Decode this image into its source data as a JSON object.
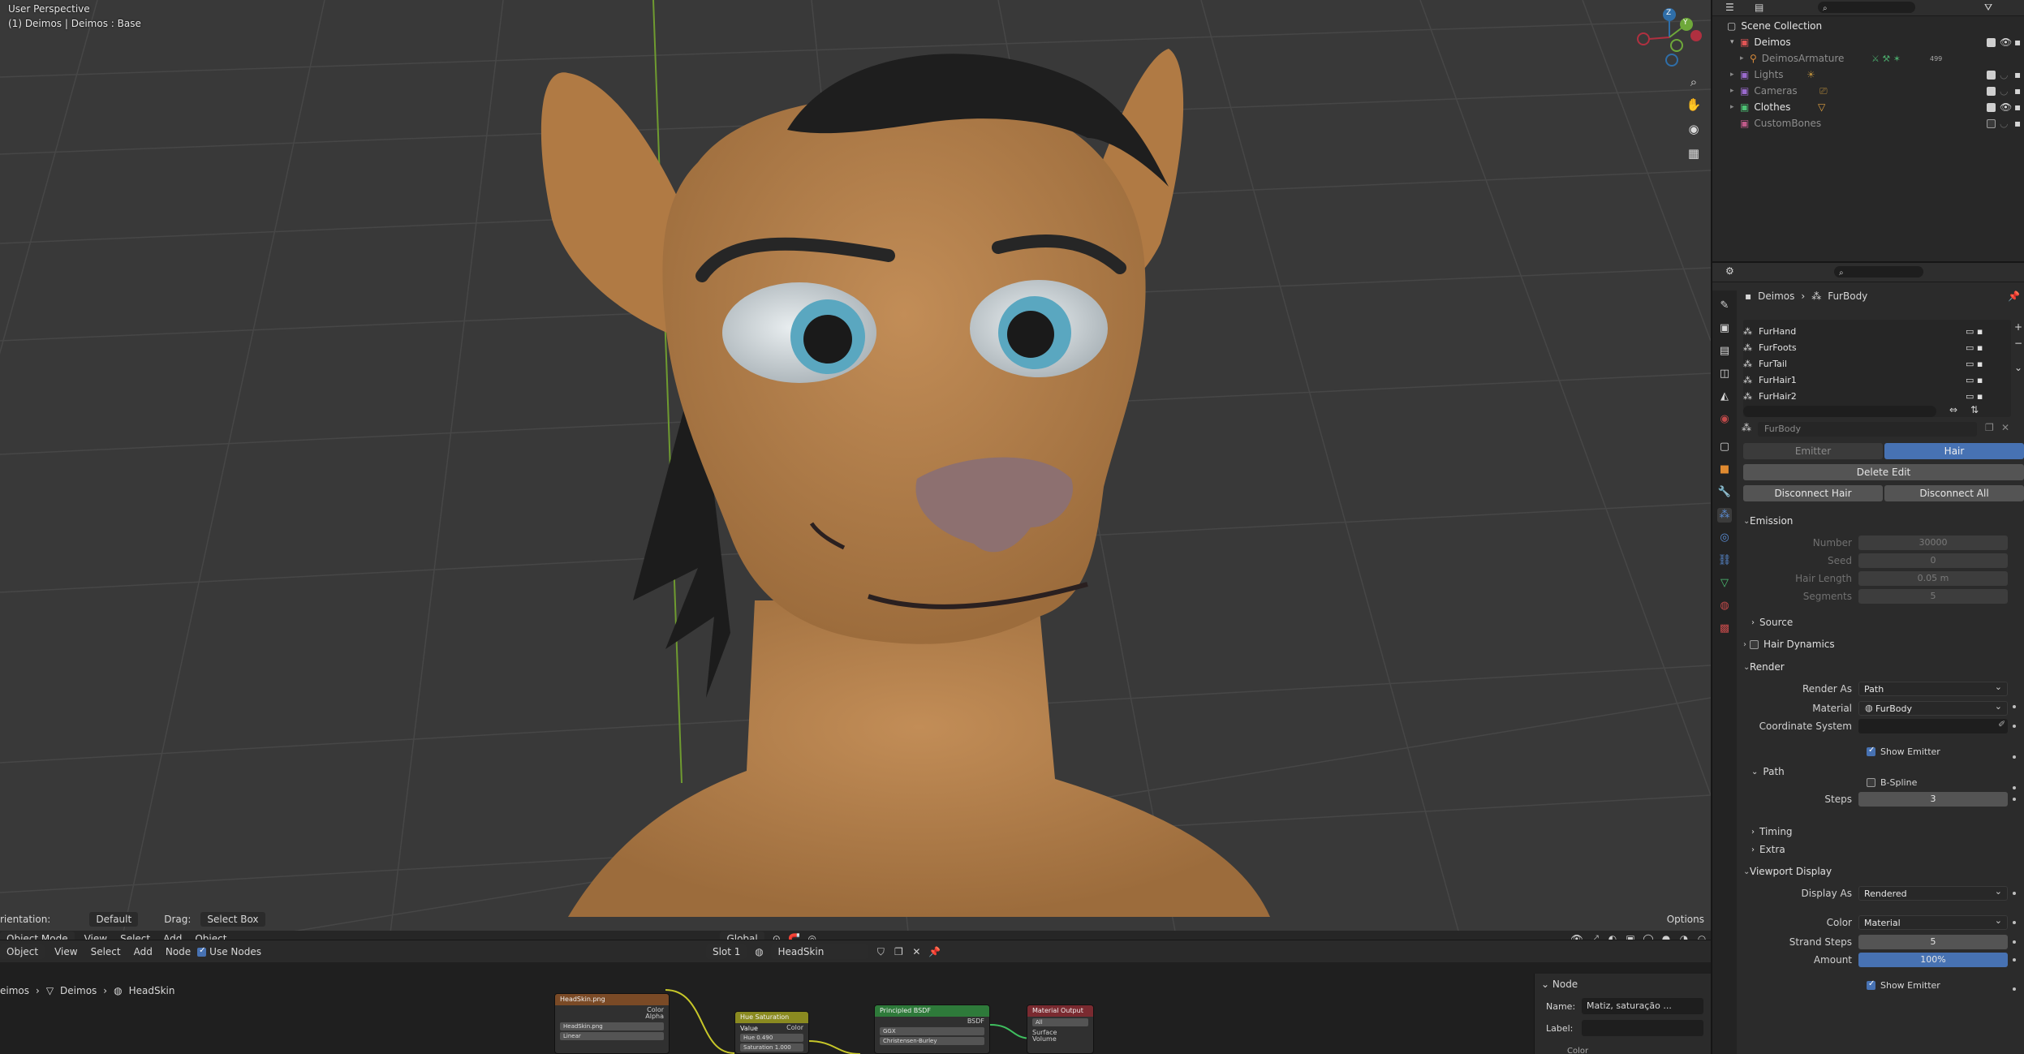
{
  "viewport": {
    "perspective_label": "User Perspective",
    "object_label": "(1) Deimos | Deimos : Base",
    "toolbar": {
      "orientation_label": "rientation:",
      "orientation_value": "Default",
      "drag_label": "Drag:",
      "drag_value": "Select Box",
      "options_label": "Options"
    },
    "header": {
      "mode": "Object Mode",
      "menus": [
        "View",
        "Select",
        "Add",
        "Object"
      ],
      "transform_orientation": "Global"
    },
    "gizmo": {
      "z_label": "Z",
      "y_label": "Y"
    }
  },
  "node_editor": {
    "header": {
      "type": "Object",
      "menus": [
        "View",
        "Select",
        "Add",
        "Node"
      ],
      "use_nodes_label": "Use Nodes",
      "slot": "Slot 1",
      "material": "HeadSkin"
    },
    "breadcrumb": [
      "eimos",
      "Deimos",
      "HeadSkin"
    ],
    "nodes": [
      {
        "title": "HeadSkin.png",
        "rows": [
          "Color",
          "Alpha"
        ],
        "fields": [
          "HeadSkin.png",
          "Linear"
        ]
      },
      {
        "title": "Hue Saturation Value",
        "rows": [
          "Color"
        ],
        "fields": [
          "Hue   0.490",
          "Saturation   1.000"
        ]
      },
      {
        "title": "Principled BSDF",
        "rows": [
          "BSDF"
        ],
        "fields": [
          "GGX",
          "Christensen-Burley"
        ]
      },
      {
        "title": "Material Output",
        "rows": [
          "Surface",
          "Volume"
        ],
        "fields": [
          "All"
        ]
      }
    ],
    "sidebar": {
      "section": "Node",
      "name_label": "Name:",
      "name_value": "Matiz, saturação ...",
      "label_label": "Label:",
      "color_label": "Color"
    }
  },
  "outliner": {
    "root": "Scene Collection",
    "items": [
      {
        "name": "Deimos",
        "visible": true
      },
      {
        "name": "DeimosArmature",
        "visible": false,
        "count": "499"
      },
      {
        "name": "Lights",
        "visible": false
      },
      {
        "name": "Cameras",
        "visible": false
      },
      {
        "name": "Clothes",
        "visible": true
      },
      {
        "name": "CustomBones",
        "visible": false
      }
    ]
  },
  "properties": {
    "breadcrumb": [
      "Deimos",
      "FurBody"
    ],
    "particle_systems": [
      "FurHand",
      "FurFoots",
      "FurTail",
      "FurHair1",
      "FurHair2"
    ],
    "settings_name": "FurBody",
    "type_tabs": [
      "Emitter",
      "Hair"
    ],
    "active_type": "Hair",
    "delete_edit": "Delete Edit",
    "disconnect_hair": "Disconnect Hair",
    "disconnect_all": "Disconnect All",
    "emission": {
      "title": "Emission",
      "number_label": "Number",
      "number": "30000",
      "seed_label": "Seed",
      "seed": "0",
      "hair_length_label": "Hair Length",
      "hair_length": "0.05 m",
      "segments_label": "Segments",
      "segments": "5"
    },
    "source_label": "Source",
    "hair_dynamics_label": "Hair Dynamics",
    "render": {
      "title": "Render",
      "render_as_label": "Render As",
      "render_as": "Path",
      "material_label": "Material",
      "material": "FurBody",
      "coord_label": "Coordinate System",
      "show_emitter_label": "Show Emitter"
    },
    "path": {
      "title": "Path",
      "bspline_label": "B-Spline",
      "steps_label": "Steps",
      "steps": "3"
    },
    "timing_label": "Timing",
    "extra_label": "Extra",
    "viewport_display": {
      "title": "Viewport Display",
      "display_as_label": "Display As",
      "display_as": "Rendered",
      "color_label": "Color",
      "color": "Material",
      "strand_steps_label": "Strand Steps",
      "strand_steps": "5",
      "amount_label": "Amount",
      "amount": "100%",
      "show_emitter_label": "Show Emitter"
    }
  },
  "colors": {
    "accent": "#4772b3",
    "skin": "#b9844e",
    "iris": "#5aa7c0"
  }
}
